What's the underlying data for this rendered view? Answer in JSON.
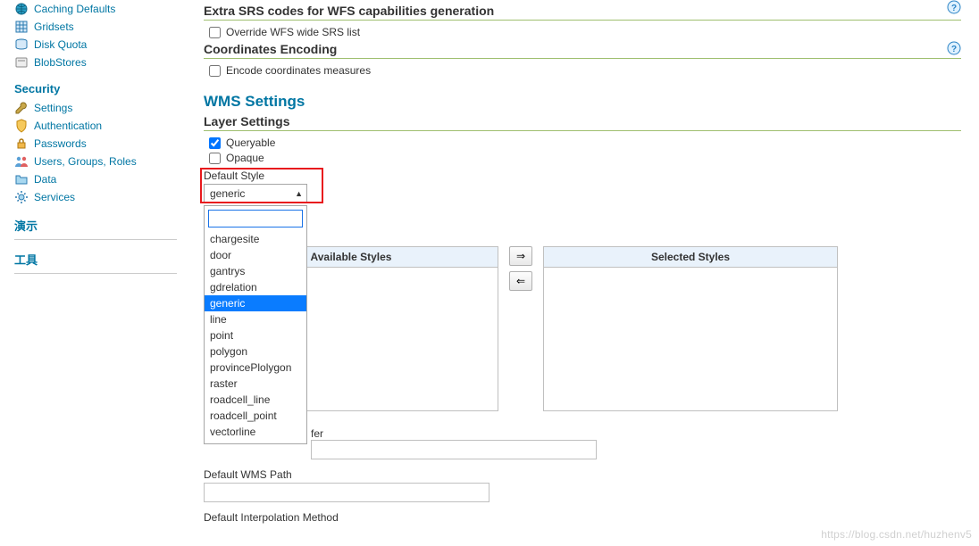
{
  "sidebar": {
    "group1": [
      {
        "icon": "globe-icon",
        "label": "Caching Defaults"
      },
      {
        "icon": "grid-icon",
        "label": "Gridsets"
      },
      {
        "icon": "disk-icon",
        "label": "Disk Quota"
      },
      {
        "icon": "blob-icon",
        "label": "BlobStores"
      }
    ],
    "security_heading": "Security",
    "security_items": [
      {
        "icon": "wrench-icon",
        "label": "Settings"
      },
      {
        "icon": "shield-icon",
        "label": "Authentication"
      },
      {
        "icon": "lock-icon",
        "label": "Passwords"
      },
      {
        "icon": "users-icon",
        "label": "Users, Groups, Roles"
      },
      {
        "icon": "folder-icon",
        "label": "Data"
      },
      {
        "icon": "gear-icon",
        "label": "Services"
      }
    ],
    "demo_heading": "演示",
    "tools_heading": "工具"
  },
  "main": {
    "srs": {
      "title": "Extra SRS codes for WFS capabilities generation",
      "override_label": "Override WFS wide SRS list"
    },
    "coords": {
      "title": "Coordinates Encoding",
      "encode_label": "Encode coordinates measures"
    },
    "wms_title": "WMS Settings",
    "layer_settings_title": "Layer Settings",
    "queryable_label": "Queryable",
    "opaque_label": "Opaque",
    "default_style_label": "Default Style",
    "default_style_value": "generic",
    "style_options": [
      "chargesite",
      "door",
      "gantrys",
      "gdrelation",
      "generic",
      "line",
      "point",
      "polygon",
      "provincePlolygon",
      "raster",
      "roadcell_line",
      "roadcell_point",
      "vectorline"
    ],
    "available_styles_title": "Available Styles",
    "selected_styles_title": "Selected Styles",
    "move_right": "⇒",
    "move_left": "⇐",
    "fer_fragment": "fer",
    "default_wms_path_label": "Default WMS Path",
    "default_interpolation_label": "Default Interpolation Method"
  },
  "watermark": "https://blog.csdn.net/huzhenv5"
}
